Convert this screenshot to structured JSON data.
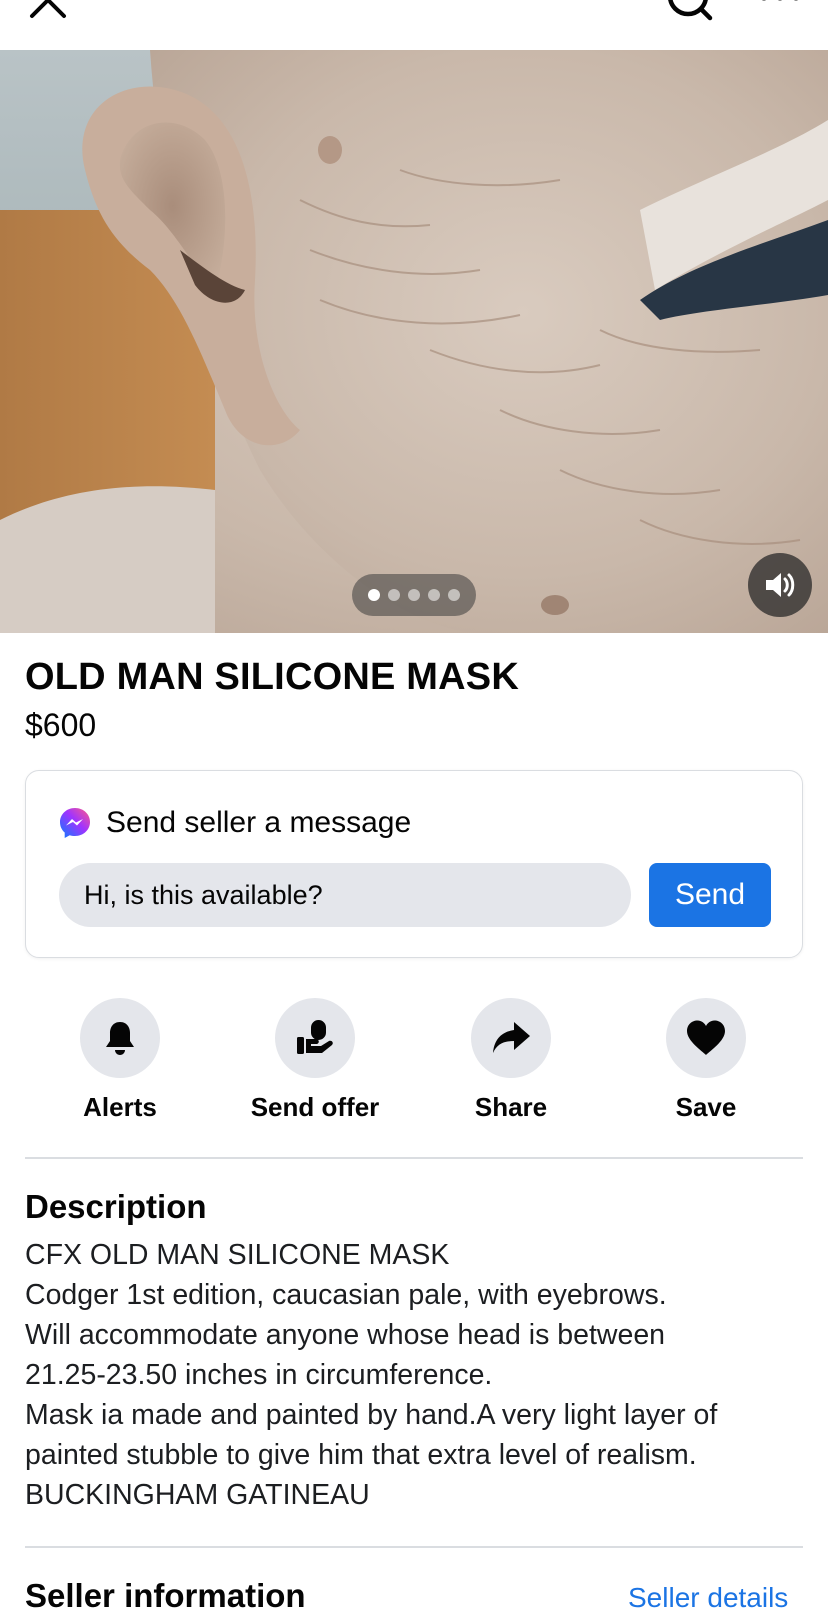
{
  "header": {
    "close_icon": "close-icon",
    "search_icon": "search-icon",
    "more_icon": "more-icon"
  },
  "gallery": {
    "photo_count": 5,
    "active_index": 0,
    "sound_icon": "speaker-icon"
  },
  "listing": {
    "title": "OLD MAN SILICONE MASK",
    "price": "$600"
  },
  "message": {
    "heading": "Send seller a message",
    "input_value": "Hi, is this available?",
    "send_label": "Send",
    "icon": "messenger-icon"
  },
  "actions": [
    {
      "label": "Alerts",
      "icon": "bell-icon"
    },
    {
      "label": "Send offer",
      "icon": "offer-icon"
    },
    {
      "label": "Share",
      "icon": "share-icon"
    },
    {
      "label": "Save",
      "icon": "heart-icon"
    }
  ],
  "description": {
    "heading": "Description",
    "lines": [
      "CFX OLD MAN SILICONE MASK",
      "Codger 1st edition, caucasian pale, with eyebrows.",
      "Will accommodate anyone whose head is between",
      "21.25-23.50 inches in circumference.",
      "Mask ia made and painted by hand.A very light layer of",
      "painted stubble to give him that extra level of realism.",
      "BUCKINGHAM GATINEAU"
    ]
  },
  "seller": {
    "heading": "Seller information",
    "link_label": "Seller details"
  },
  "colors": {
    "accent": "#1b74e4",
    "button_bg": "#e4e6eb",
    "divider": "#dadde1"
  }
}
